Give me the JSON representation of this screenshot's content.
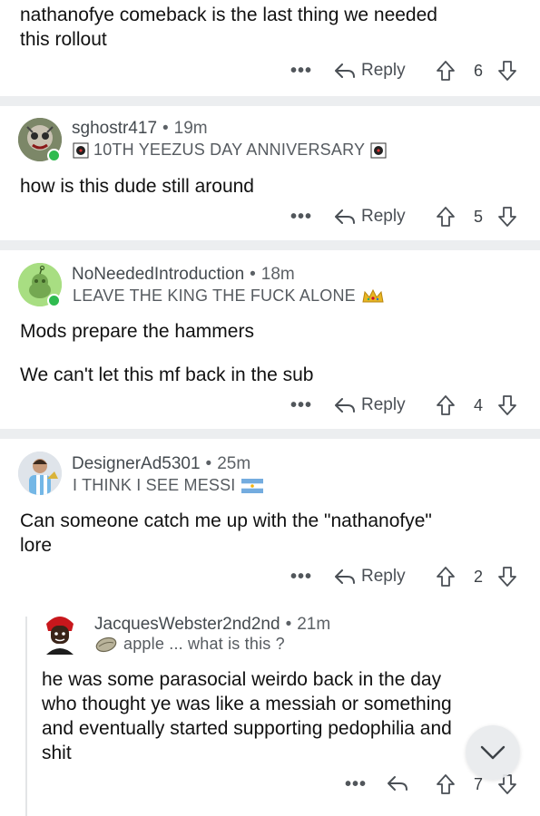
{
  "comments": [
    {
      "body_lines": [
        "nathanofye comeback is the last thing we needed",
        "this rollout"
      ],
      "reply_label": "Reply",
      "votes": "6"
    },
    {
      "username": "sghostr417",
      "age": "19m",
      "flair": "10TH YEEZUS DAY ANNIVERSARY",
      "body_lines": [
        "how is this dude still around"
      ],
      "reply_label": "Reply",
      "votes": "5",
      "online": true
    },
    {
      "username": "NoNeededIntroduction",
      "age": "18m",
      "flair": "LEAVE THE KING THE FUCK ALONE",
      "body_lines": [
        "Mods prepare the hammers",
        "We can't let this mf back in the sub"
      ],
      "reply_label": "Reply",
      "votes": "4",
      "online": true
    },
    {
      "username": "DesignerAd5301",
      "age": "25m",
      "flair": "I THINK I SEE MESSI",
      "body_lines": [
        "Can someone catch me up with the \"nathanofye\"",
        "lore"
      ],
      "reply_label": "Reply",
      "votes": "2"
    },
    {
      "username": "JacquesWebster2nd2nd",
      "age": "21m",
      "flair": "apple ... what is this ?",
      "body_lines": [
        "he was some parasocial weirdo back in the day",
        "who thought ye was like a messiah or something",
        "and eventually started supporting pedophilia and",
        "shit"
      ],
      "votes": "7"
    }
  ],
  "separator": "•",
  "more_label": "•••",
  "colors": {
    "online": "#2fbb4f",
    "divider": "#eceef0",
    "text": "#111111",
    "meta": "#5c6166"
  },
  "icons": [
    "more-options-icon",
    "reply-arrow-icon",
    "upvote-icon",
    "downvote-icon",
    "chevron-down-icon",
    "crown-icon",
    "argentina-flag-icon",
    "yeezus-cd-icon",
    "oyster-icon"
  ]
}
